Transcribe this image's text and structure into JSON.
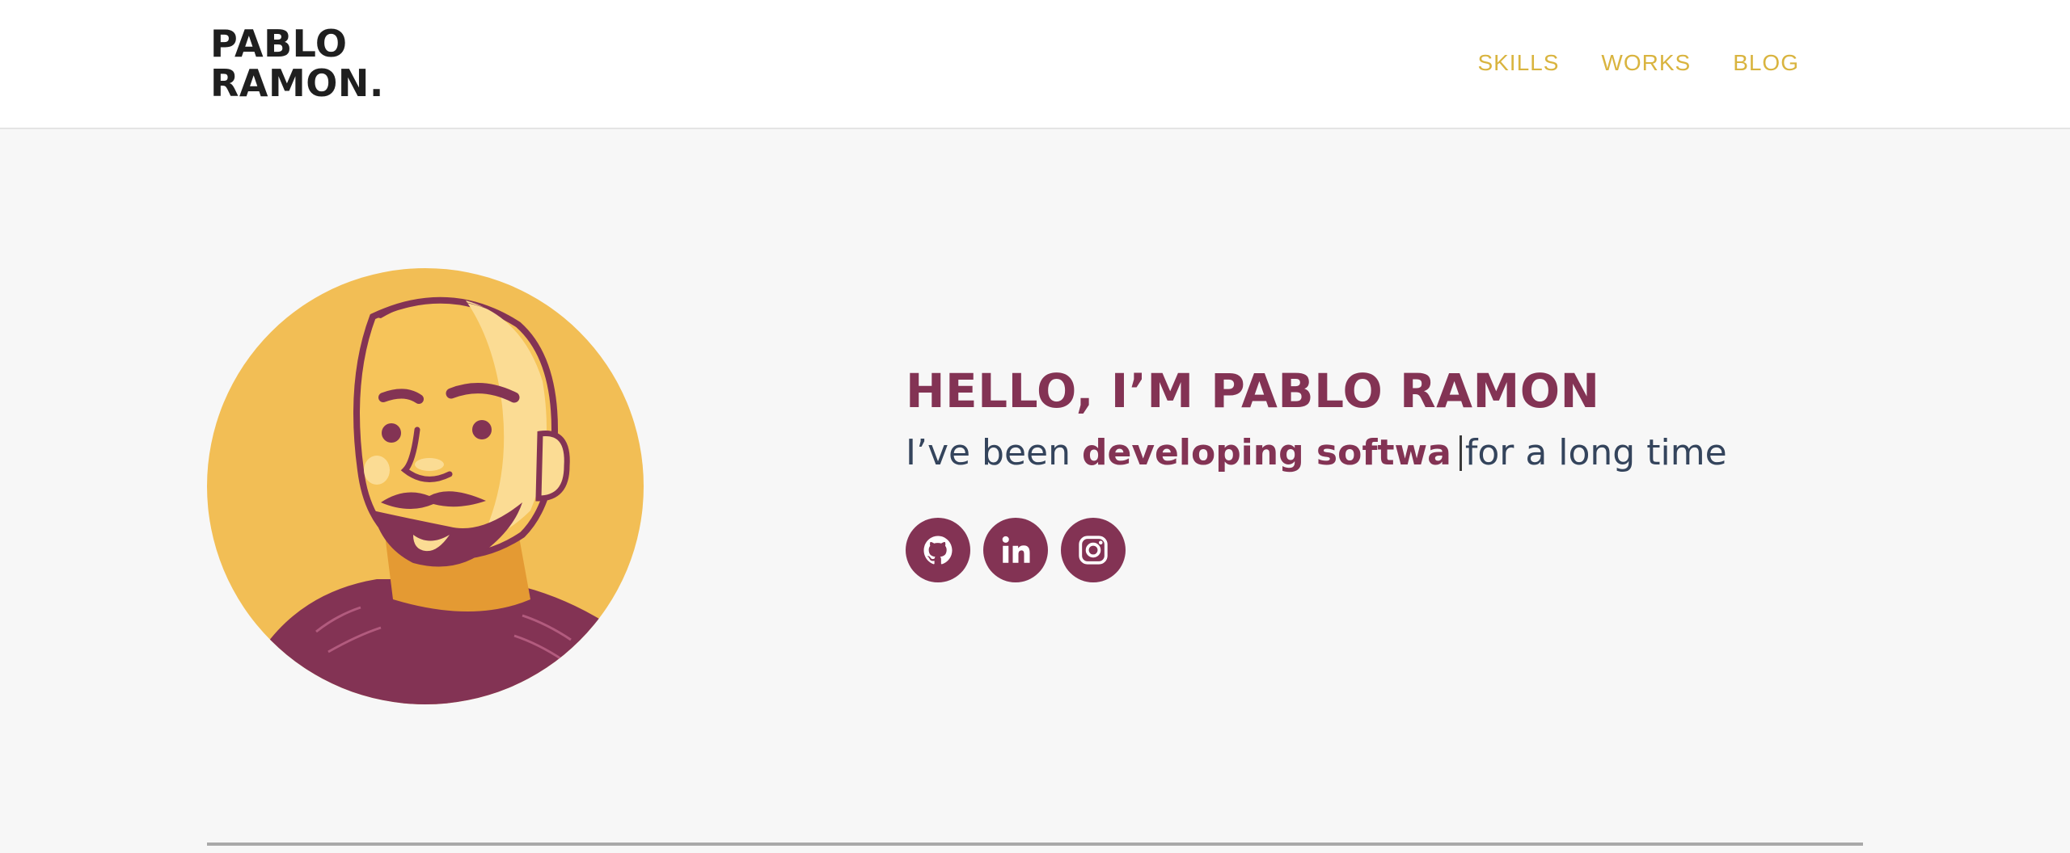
{
  "header": {
    "logo_line1": "PABLO",
    "logo_line2": "RAMON.",
    "nav": [
      {
        "label": "SKILLS"
      },
      {
        "label": "WORKS"
      },
      {
        "label": "BLOG"
      }
    ]
  },
  "hero": {
    "headline": "HELLO, I’M PABLO RAMON",
    "sub_prefix": "I’ve been ",
    "sub_highlight": "developing softwa",
    "sub_suffix": "for a long time",
    "socials": [
      {
        "icon": "github-icon"
      },
      {
        "icon": "linkedin-icon"
      },
      {
        "icon": "instagram-icon"
      }
    ]
  },
  "colors": {
    "accent": "#833354",
    "nav": "#d9b43f",
    "avatar_bg": "#f2be55",
    "text_dark": "#34445c"
  }
}
